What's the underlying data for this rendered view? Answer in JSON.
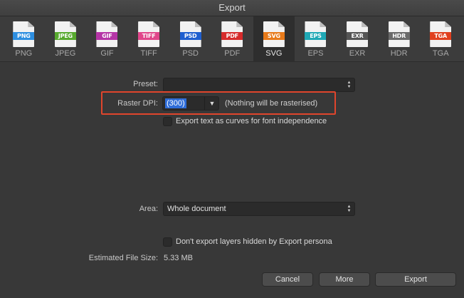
{
  "window": {
    "title": "Export"
  },
  "formats": [
    {
      "badge": "PNG",
      "label": "PNG",
      "color": "#2d8ee0"
    },
    {
      "badge": "JPEG",
      "label": "JPEG",
      "color": "#57a92e"
    },
    {
      "badge": "GIF",
      "label": "GIF",
      "color": "#b534a6"
    },
    {
      "badge": "TIFF",
      "label": "TIFF",
      "color": "#e0468a"
    },
    {
      "badge": "PSD",
      "label": "PSD",
      "color": "#1f5fcf"
    },
    {
      "badge": "PDF",
      "label": "PDF",
      "color": "#d62b2b"
    },
    {
      "badge": "SVG",
      "label": "SVG",
      "color": "#e77a1a"
    },
    {
      "badge": "EPS",
      "label": "EPS",
      "color": "#1fa8b5"
    },
    {
      "badge": "EXR",
      "label": "EXR",
      "color": "#555555"
    },
    {
      "badge": "HDR",
      "label": "HDR",
      "color": "#6a6a6a"
    },
    {
      "badge": "TGA",
      "label": "TGA",
      "color": "#e0401f"
    }
  ],
  "selected_format": "SVG",
  "preset": {
    "label": "Preset:",
    "value": ""
  },
  "raster_dpi": {
    "label": "Raster DPI:",
    "value": "(300)",
    "note": "(Nothing will be rasterised)"
  },
  "curves_checkbox": {
    "label": "Export text as curves for font independence",
    "checked": false
  },
  "area": {
    "label": "Area:",
    "value": "Whole document"
  },
  "hidden_layers_checkbox": {
    "label": "Don't export layers hidden by Export persona",
    "checked": false
  },
  "file_size": {
    "label": "Estimated File Size:",
    "value": "5.33 MB"
  },
  "buttons": {
    "cancel": "Cancel",
    "more": "More",
    "export": "Export"
  },
  "icons": {
    "updown": "updown-arrows-icon",
    "dropdown": "chevron-down-icon"
  }
}
